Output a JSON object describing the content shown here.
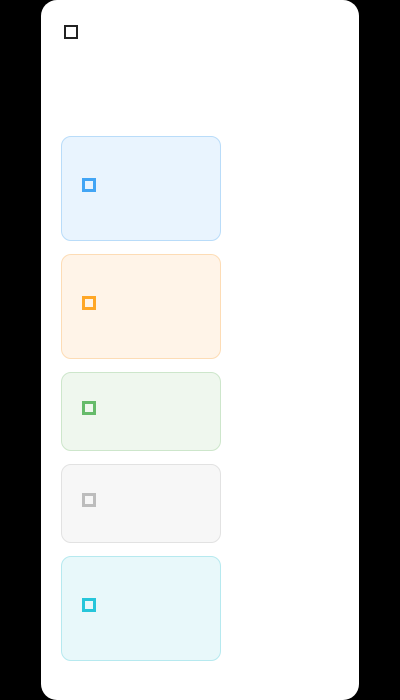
{
  "header": {
    "title": "",
    "heading": "",
    "meta": [
      "",
      "",
      ""
    ],
    "link": ""
  },
  "cards": [
    {
      "label": "",
      "sub": "",
      "color": "#42a5f5",
      "bg": "#e9f4fe",
      "border": "#b9dcf9"
    },
    {
      "label": "",
      "sub": "",
      "color": "#ffa726",
      "bg": "#fff4e8",
      "border": "#fddcb5"
    },
    {
      "label": "",
      "sub": "",
      "color": "#66bb6a",
      "bg": "#eff7ee",
      "border": "#cde6cb"
    },
    {
      "label": "",
      "sub": "",
      "color": "#bdbdbd",
      "bg": "#f7f7f7",
      "border": "#e2e2e2"
    },
    {
      "label": "",
      "sub": "",
      "color": "#26c6da",
      "bg": "#e8f8fa",
      "border": "#b6e9ef"
    }
  ]
}
